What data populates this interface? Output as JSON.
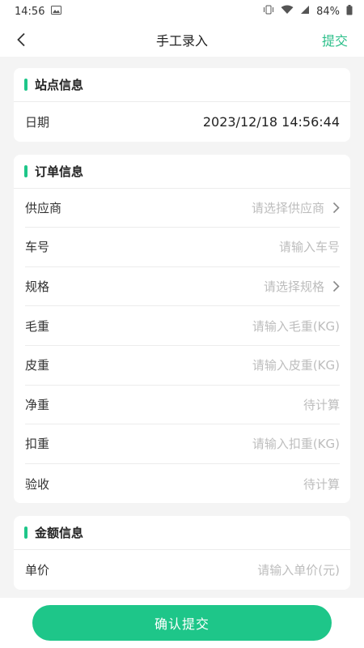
{
  "status_bar": {
    "time": "14:56",
    "battery": "84%",
    "icons": [
      "image-icon",
      "vibrate-icon",
      "wifi-icon",
      "signal-icon",
      "battery-icon"
    ]
  },
  "nav": {
    "title": "手工录入",
    "submit_label": "提交",
    "back_icon": "chevron-left-icon",
    "accent_color": "#2cbf8a"
  },
  "station_section": {
    "title": "站点信息",
    "rows": [
      {
        "label": "日期",
        "value": "2023/12/18 14:56:44"
      }
    ]
  },
  "order_section": {
    "title": "订单信息",
    "rows": [
      {
        "label": "供应商",
        "placeholder": "请选择供应商"
      },
      {
        "label": "车号",
        "placeholder": "请输入车号"
      },
      {
        "label": "规格",
        "placeholder": "请选择规格"
      },
      {
        "label": "毛重",
        "placeholder": "请输入毛重(KG)"
      },
      {
        "label": "皮重",
        "placeholder": "请输入皮重(KG)"
      },
      {
        "label": "净重",
        "placeholder": "待计算"
      },
      {
        "label": "扣重",
        "placeholder": "请输入扣重(KG)"
      },
      {
        "label": "验收",
        "placeholder": "待计算"
      }
    ]
  },
  "amount_section": {
    "title": "金额信息",
    "rows": [
      {
        "label": "单价",
        "placeholder": "请输入单价(元)"
      }
    ]
  },
  "confirm_button": {
    "label": "确认提交",
    "color": "#1ec689"
  }
}
